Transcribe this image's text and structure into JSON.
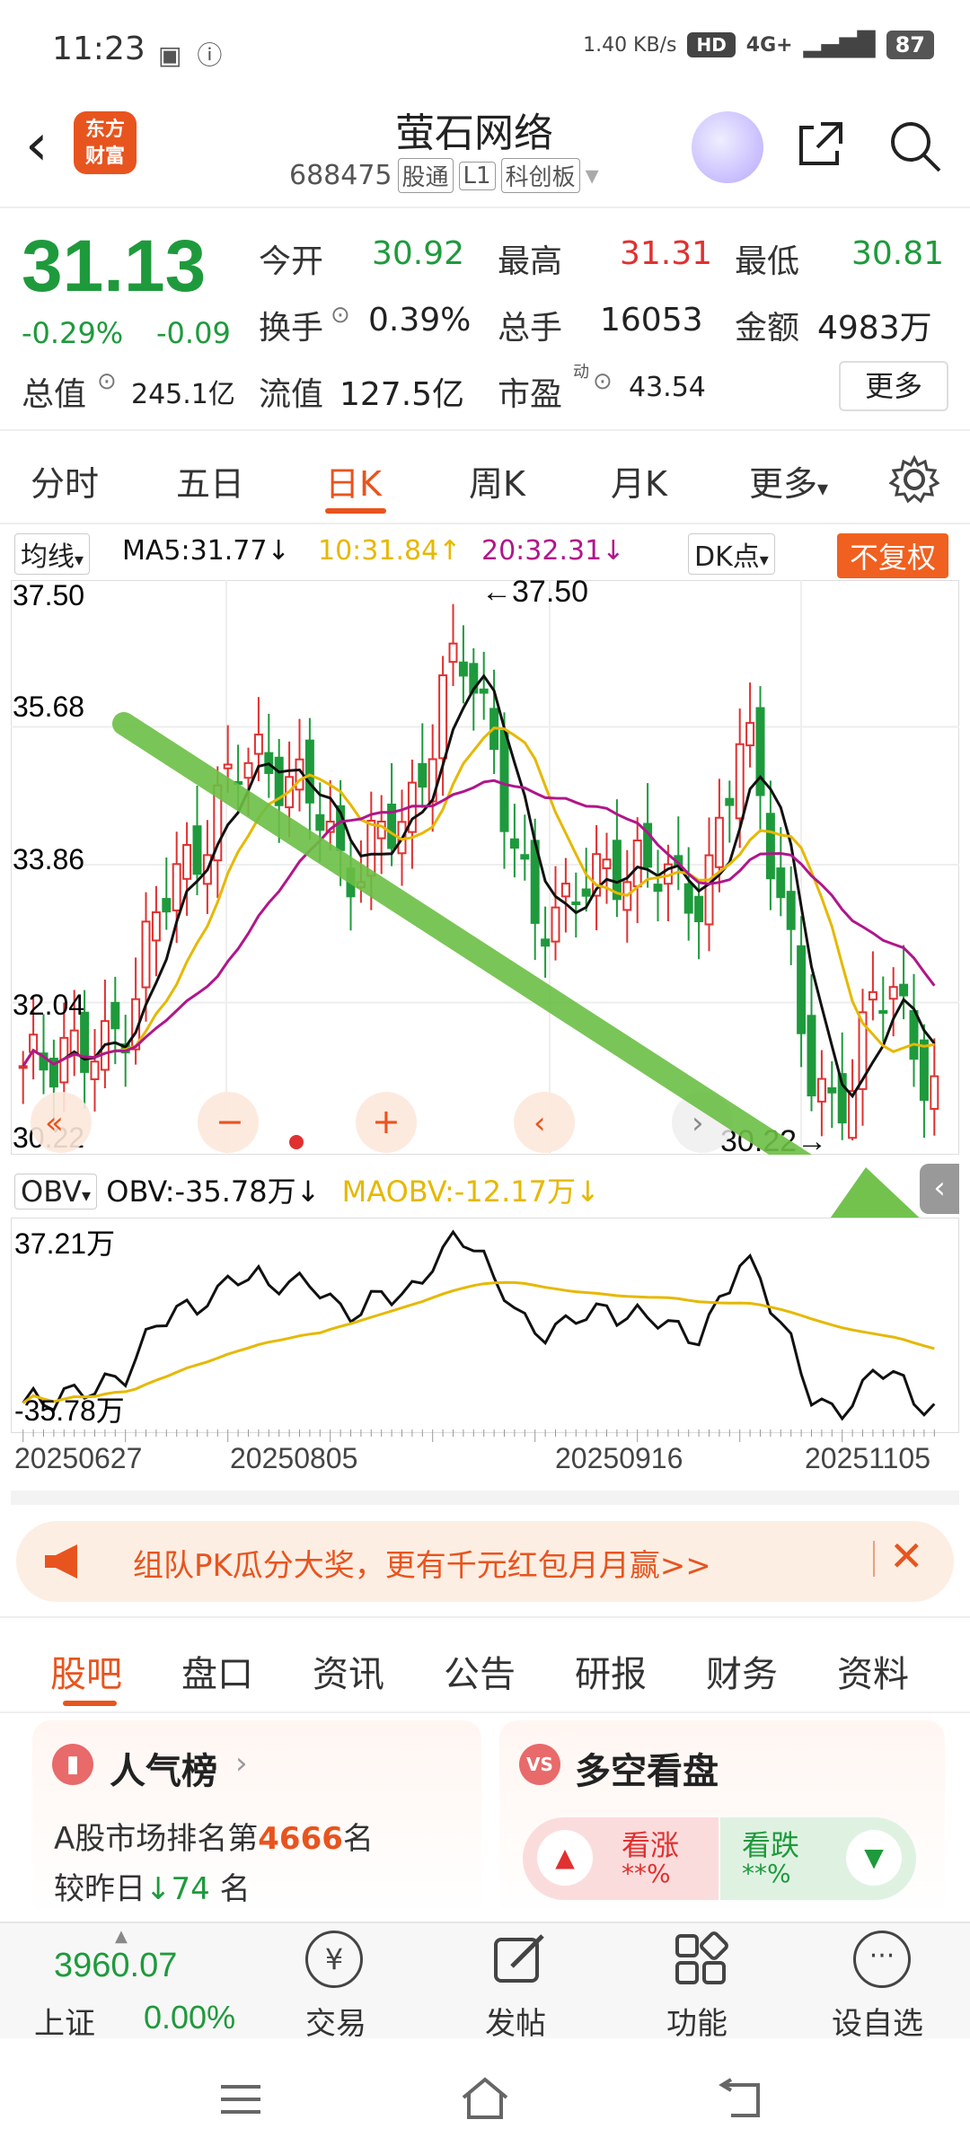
{
  "status": {
    "time": "11:23",
    "net_speed": "1.40 KB/s",
    "hd": "HD",
    "signal": "4G+",
    "battery": "87"
  },
  "header": {
    "logo_line1": "东方",
    "logo_line2": "财富",
    "name": "萤石网络",
    "code": "688475",
    "tag1": "股通",
    "tag2": "L1",
    "board": "科创板"
  },
  "quote": {
    "price": "31.13",
    "change_pct": "-0.29%",
    "change": "-0.09",
    "open_label": "今开",
    "open": "30.92",
    "high_label": "最高",
    "high": "31.31",
    "low_label": "最低",
    "low": "30.81",
    "turnover_label": "换手",
    "turnover": "0.39%",
    "volume_label": "总手",
    "volume": "16053",
    "amount_label": "金额",
    "amount": "4983万",
    "mcap_label": "总值",
    "mcap": "245.1亿",
    "float_label": "流值",
    "float": "127.5亿",
    "pe_label": "市盈",
    "pe_sup": "动",
    "pe": "43.54",
    "more": "更多"
  },
  "ktabs": [
    "分时",
    "五日",
    "日K",
    "周K",
    "月K",
    "更多"
  ],
  "chart": {
    "ma_select": "均线",
    "ma5": "MA5:31.77↓",
    "ma10": "10:31.84↑",
    "ma20": "20:32.31↓",
    "dk": "DK点",
    "adjust": "不复权",
    "y_labels": [
      "37.50",
      "35.68",
      "33.86",
      "32.04",
      "30.22"
    ],
    "max_label": "←37.50",
    "min_label": "30.22→",
    "obv_select": "OBV",
    "obv_value": "OBV:-35.78万↓",
    "maobv_value": "MAOBV:-12.17万↓",
    "obv_top": "37.21万",
    "obv_bottom": "-35.78万",
    "x_labels": [
      "20250627",
      "20250805",
      "20250916",
      "20251105"
    ],
    "colors": {
      "up": "#e03030",
      "down": "#1e9a3c",
      "ma5": "#111111",
      "ma10": "#e6b800",
      "ma20": "#b0168a",
      "arrow": "#6cbf45"
    }
  },
  "chart_data": {
    "type": "candlestick",
    "ylim": [
      30.22,
      37.5
    ],
    "max_price": 37.5,
    "min_price": 30.22,
    "x_ticks": [
      "20250627",
      "20250805",
      "20250916",
      "20251105"
    ],
    "series": [
      {
        "name": "MA5",
        "last": 31.77
      },
      {
        "name": "MA10",
        "last": 31.84
      },
      {
        "name": "MA20",
        "last": 32.31
      },
      {
        "name": "OBV",
        "last": "-35.78万"
      },
      {
        "name": "MAOBV",
        "last": "-12.17万"
      }
    ],
    "close_path": [
      31.0,
      31.3,
      31.6,
      31.2,
      31.4,
      32.0,
      33.0,
      33.5,
      34.0,
      34.6,
      35.0,
      35.3,
      35.2,
      34.8,
      34.5,
      34.0,
      33.8,
      34.2,
      34.5,
      35.3,
      36.2,
      36.6,
      35.8,
      34.2,
      33.0,
      33.3,
      33.6,
      33.5,
      33.8,
      34.0,
      33.7,
      33.4,
      33.6,
      34.4,
      35.6,
      34.6,
      33.2,
      31.0,
      30.6,
      31.1,
      31.9,
      32.2,
      31.6,
      30.9
    ]
  },
  "banner": {
    "text": "组队PK瓜分大奖，更有千元红包月月赢>>"
  },
  "bottom_tabs": [
    "股吧",
    "盘口",
    "资讯",
    "公告",
    "研报",
    "财务",
    "资料"
  ],
  "cards": {
    "popularity_title": "人气榜",
    "rank_prefix": "A股市场排名第",
    "rank": "4666",
    "rank_suffix": "名",
    "yesterday_prefix": "较昨日",
    "yesterday_change": "74",
    "yesterday_suffix": "名",
    "vs_title": "多空看盘",
    "up_label": "看涨",
    "up_pct": "**%",
    "down_label": "看跌",
    "down_pct": "**%"
  },
  "bottom_nav": {
    "index_value": "3960.07",
    "index_name": "上证",
    "index_change": "0.00%",
    "trade": "交易",
    "post": "发帖",
    "functions": "功能",
    "add_watch": "设自选"
  }
}
